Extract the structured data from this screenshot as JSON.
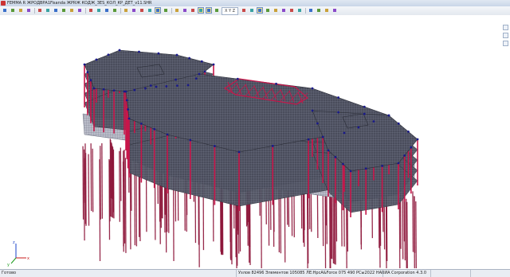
{
  "window": {
    "title": "FEMMA R ЖРОДВРА1Fisanda ЖРRЖ КОДЖ_ЗЕS_КОЛ_КР_ДЕТ_v11.SНR"
  },
  "toolbar": {
    "buttons": [
      {
        "icon": "new-file-icon",
        "active": false
      },
      {
        "icon": "open-folder-icon",
        "active": false
      },
      {
        "icon": "save-icon",
        "active": false
      },
      {
        "icon": "print-icon",
        "active": false
      },
      {
        "icon": "zoom-in-icon",
        "active": false
      },
      {
        "icon": "zoom-out-icon",
        "active": false
      },
      {
        "icon": "zoom-window-icon",
        "active": false
      },
      {
        "icon": "zoom-extents-icon",
        "active": false
      },
      {
        "icon": "pan-icon",
        "active": false
      },
      {
        "icon": "rotate-icon",
        "active": false
      },
      {
        "icon": "view-front-icon",
        "active": false
      },
      {
        "icon": "view-top-icon",
        "active": false
      },
      {
        "icon": "view-side-icon",
        "active": false
      },
      {
        "icon": "view-iso-icon",
        "active": false
      },
      {
        "icon": "mesh-icon",
        "active": false
      },
      {
        "icon": "nodes-icon",
        "active": false
      },
      {
        "icon": "elements-icon",
        "active": false
      },
      {
        "icon": "fill-icon",
        "active": false
      },
      {
        "icon": "shading-icon",
        "active": true
      },
      {
        "icon": "wireframe-icon",
        "active": false
      },
      {
        "icon": "select-icon",
        "active": false
      },
      {
        "icon": "filter-icon",
        "active": false
      },
      {
        "icon": "section-icon",
        "active": false
      },
      {
        "icon": "results-icon",
        "active": true
      },
      {
        "icon": "deform-icon",
        "active": true
      },
      {
        "icon": "isolines-icon",
        "active": false
      },
      {
        "icon": "loads-icon",
        "active": false
      },
      {
        "icon": "supports-icon",
        "active": false
      },
      {
        "icon": "layers-icon",
        "active": false
      },
      {
        "icon": "numbering-icon",
        "active": false
      },
      {
        "icon": "check-icon",
        "active": true
      },
      {
        "icon": "grid-icon",
        "active": false
      },
      {
        "icon": "axes-icon",
        "active": false
      },
      {
        "icon": "hide-icon",
        "active": false
      },
      {
        "icon": "show-icon",
        "active": false
      },
      {
        "icon": "copy-icon",
        "active": false
      },
      {
        "icon": "undo-icon",
        "active": false
      },
      {
        "icon": "redo-icon",
        "active": false
      },
      {
        "icon": "calc-icon",
        "active": false
      },
      {
        "icon": "report-icon",
        "active": false
      }
    ],
    "right_field": "X   Y   Z"
  },
  "view": {
    "axis_labels": {
      "x": "x",
      "y": "y",
      "z": "z"
    },
    "colors": {
      "slab": "#4a4d5c",
      "mesh": "#8d92a6",
      "column": "#c8164a",
      "pile": "#8c1438",
      "node": "#1a1a8a",
      "foundation": "#b9bcc8"
    }
  },
  "status": {
    "left": "Готово",
    "center": "Узлов 82496  Элементов 105085  ЛЕ:НрсА&Force 075 490 РСы2022 НАВИА Corporation 4.3.0",
    "right": ""
  }
}
